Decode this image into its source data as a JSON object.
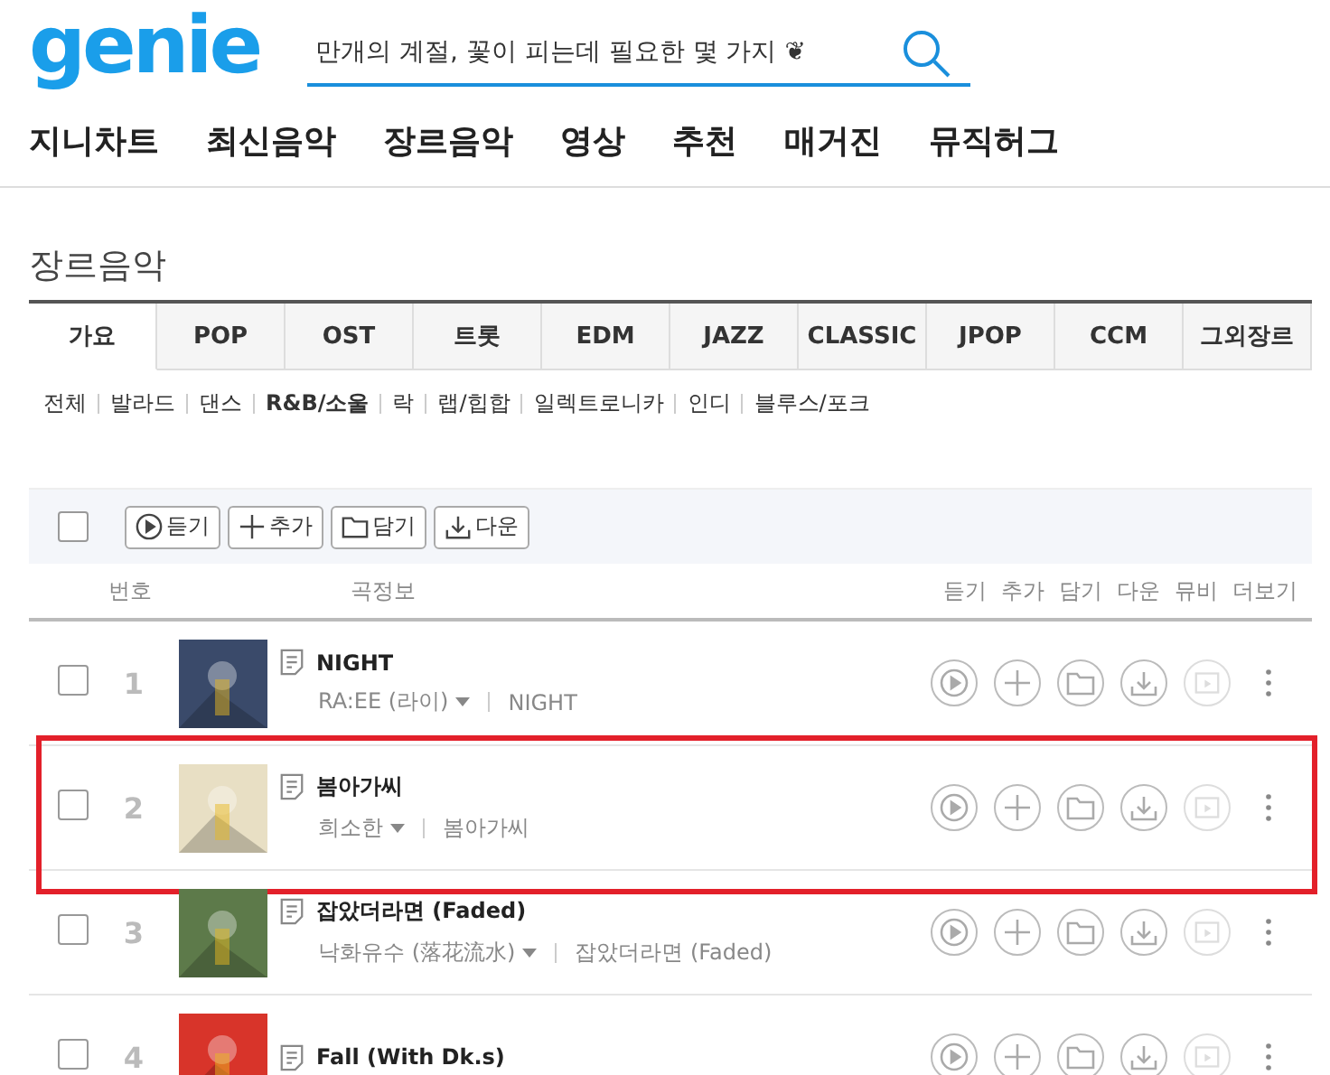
{
  "logo": "genie",
  "search": {
    "value": "만개의 계절, 꽃이 피는데 필요한 몇 가지 ❦"
  },
  "nav": [
    "지니차트",
    "최신음악",
    "장르음악",
    "영상",
    "추천",
    "매거진",
    "뮤직허그"
  ],
  "section_title": "장르음악",
  "tabs": [
    {
      "label": "가요",
      "selected": true
    },
    {
      "label": "POP",
      "selected": false
    },
    {
      "label": "OST",
      "selected": false
    },
    {
      "label": "트롯",
      "selected": false
    },
    {
      "label": "EDM",
      "selected": false
    },
    {
      "label": "JAZZ",
      "selected": false
    },
    {
      "label": "CLASSIC",
      "selected": false
    },
    {
      "label": "JPOP",
      "selected": false
    },
    {
      "label": "CCM",
      "selected": false
    },
    {
      "label": "그외장르",
      "selected": false
    }
  ],
  "subgenres": [
    {
      "label": "전체",
      "selected": false
    },
    {
      "label": "발라드",
      "selected": false
    },
    {
      "label": "댄스",
      "selected": false
    },
    {
      "label": "R&B/소울",
      "selected": true
    },
    {
      "label": "락",
      "selected": false
    },
    {
      "label": "랩/힙합",
      "selected": false
    },
    {
      "label": "일렉트로니카",
      "selected": false
    },
    {
      "label": "인디",
      "selected": false
    },
    {
      "label": "블루스/포크",
      "selected": false
    }
  ],
  "toolbar": {
    "select_all": {
      "checked": false
    },
    "buttons": [
      {
        "kind": "play",
        "label": "듣기"
      },
      {
        "kind": "add",
        "label": "추가"
      },
      {
        "kind": "folder",
        "label": "담기"
      },
      {
        "kind": "download",
        "label": "다운"
      }
    ]
  },
  "columns": {
    "number": "번호",
    "info": "곡정보",
    "actions": [
      "듣기",
      "추가",
      "담기",
      "다운",
      "뮤비",
      "더보기"
    ]
  },
  "rows": [
    {
      "rank": "1",
      "title": "NIGHT",
      "artist": "RA:EE (라이)",
      "album": "NIGHT",
      "checked": false,
      "highlighted": false
    },
    {
      "rank": "2",
      "title": "봄아가씨",
      "artist": "희소한",
      "album": "봄아가씨",
      "checked": false,
      "highlighted": true
    },
    {
      "rank": "3",
      "title": "잡았더라면 (Faded)",
      "artist": "낙화유수 (落花流水)",
      "album": "잡았더라면 (Faded)",
      "checked": false,
      "highlighted": false
    },
    {
      "rank": "4",
      "title": "Fall (With Dk.s)",
      "checked": false,
      "highlighted": false
    }
  ]
}
